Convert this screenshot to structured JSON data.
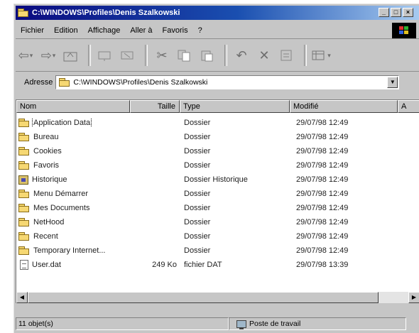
{
  "window": {
    "title": "C:\\WINDOWS\\Profiles\\Denis Szalkowski",
    "buttons": [
      "_",
      "□",
      "×"
    ]
  },
  "menu": [
    {
      "label": "Fichier"
    },
    {
      "label": "Edition"
    },
    {
      "label": "Affichage"
    },
    {
      "label": "Aller à"
    },
    {
      "label": "Favoris"
    },
    {
      "label": "?"
    }
  ],
  "address": {
    "label": "Adresse",
    "value": "C:\\WINDOWS\\Profiles\\Denis Szalkowski"
  },
  "columns": [
    {
      "label": "Nom"
    },
    {
      "label": "Taille"
    },
    {
      "label": "Type"
    },
    {
      "label": "Modifié"
    },
    {
      "label": "A"
    }
  ],
  "rows": [
    {
      "name": "Application Data",
      "size": "",
      "type": "Dossier",
      "modified": "29/07/98 12:49",
      "icon": "folder-icon"
    },
    {
      "name": "Bureau",
      "size": "",
      "type": "Dossier",
      "modified": "29/07/98 12:49",
      "icon": "folder-icon"
    },
    {
      "name": "Cookies",
      "size": "",
      "type": "Dossier",
      "modified": "29/07/98 12:49",
      "icon": "folder-icon"
    },
    {
      "name": "Favoris",
      "size": "",
      "type": "Dossier",
      "modified": "29/07/98 12:49",
      "icon": "folder-icon"
    },
    {
      "name": "Historique",
      "size": "",
      "type": "Dossier Historique",
      "modified": "29/07/98 12:49",
      "icon": "history-folder-icon"
    },
    {
      "name": "Menu Démarrer",
      "size": "",
      "type": "Dossier",
      "modified": "29/07/98 12:49",
      "icon": "folder-icon"
    },
    {
      "name": "Mes Documents",
      "size": "",
      "type": "Dossier",
      "modified": "29/07/98 12:49",
      "icon": "folder-icon"
    },
    {
      "name": "NetHood",
      "size": "",
      "type": "Dossier",
      "modified": "29/07/98 12:49",
      "icon": "folder-icon"
    },
    {
      "name": "Recent",
      "size": "",
      "type": "Dossier",
      "modified": "29/07/98 12:49",
      "icon": "folder-icon"
    },
    {
      "name": "Temporary Internet...",
      "size": "",
      "type": "Dossier",
      "modified": "29/07/98 12:49",
      "icon": "folder-icon"
    },
    {
      "name": "User.dat",
      "size": "249 Ko",
      "type": "fichier DAT",
      "modified": "29/07/98 13:39",
      "icon": "file-icon"
    }
  ],
  "status": {
    "count": "11 objet(s)",
    "location": "Poste de travail"
  }
}
